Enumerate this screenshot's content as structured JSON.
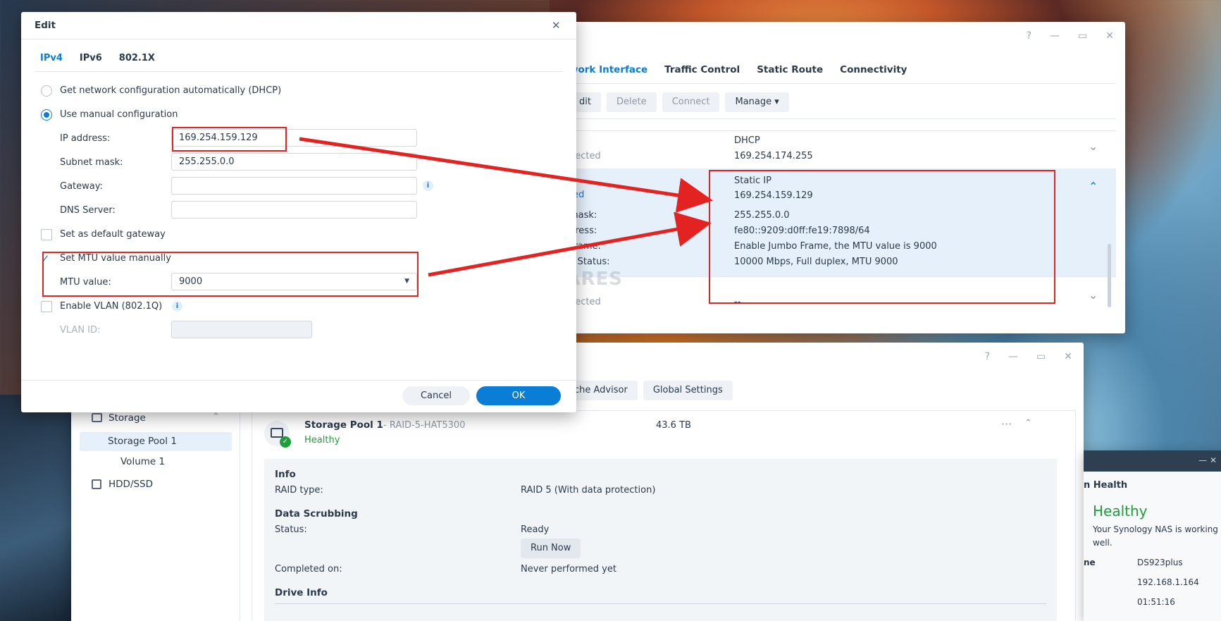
{
  "desktop": {
    "note": ""
  },
  "network_window": {
    "window_controls": {
      "help": "?",
      "minimize": "—",
      "maximize": "▭",
      "close": "✕"
    },
    "tabs": [
      "work Interface",
      "Traffic Control",
      "Static Route",
      "Connectivity"
    ],
    "toolbar": {
      "edit": "dit",
      "delete": "Delete",
      "connect": "Connect",
      "manage": "Manage ▾"
    },
    "row1": {
      "status": "nected",
      "mode": "DHCP",
      "ip": "169.254.174.255"
    },
    "row2": {
      "status": "ted",
      "mode": "Static IP",
      "ip": "169.254.159.129",
      "labels": [
        "mask:",
        "dress:",
        "Frame:",
        "k Status:"
      ],
      "values": [
        "255.255.0.0",
        "fe80::9209:d0ff:fe19:7898/64",
        "Enable Jumbo Frame, the MTU value is 9000",
        "10000 Mbps, Full duplex, MTU 9000"
      ]
    },
    "row3": {
      "status": "nected",
      "value": "--"
    },
    "watermark": "NAS COMPARES"
  },
  "edit_dialog": {
    "title": "Edit",
    "close": "✕",
    "tabs": [
      "IPv4",
      "IPv6",
      "802.1X"
    ],
    "dhcp_label": "Get network configuration automatically (DHCP)",
    "manual_label": "Use manual configuration",
    "ip_label": "IP address:",
    "ip_value": "169.254.159.129",
    "subnet_label": "Subnet mask:",
    "subnet_value": "255.255.0.0",
    "gateway_label": "Gateway:",
    "gateway_value": "",
    "dns_label": "DNS Server:",
    "dns_value": "",
    "default_gw_label": "Set as default gateway",
    "mtu_check_label": "Set MTU value manually",
    "mtu_label": "MTU value:",
    "mtu_value": "9000",
    "vlan_label": "Enable VLAN (802.1Q)",
    "vlan_id_label": "VLAN ID:",
    "vlan_id_value": "",
    "info_glyph": "i",
    "cancel": "Cancel",
    "ok": "OK"
  },
  "storage_window": {
    "window_controls": {
      "help": "?",
      "minimize": "—",
      "maximize": "▭",
      "close": "✕"
    },
    "toolbar": {
      "cache_advisor": "che Advisor",
      "global_settings": "Global Settings"
    },
    "sidebar": {
      "storage": "Storage",
      "pool": "Storage Pool 1",
      "volume": "Volume 1",
      "hdd": "HDD/SSD"
    },
    "pool": {
      "name": "Storage Pool 1",
      "sub": "- RAID-5-HAT5300",
      "size": "43.6 TB",
      "health": "Healthy",
      "more": "···",
      "collapse": "⌃"
    },
    "info": {
      "info_h": "Info",
      "raid_label": "RAID type:",
      "raid_value": "RAID 5 (With data protection)",
      "scrub_h": "Data Scrubbing",
      "status_label": "Status:",
      "status_value": "Ready",
      "run_now": "Run Now",
      "completed_label": "Completed on:",
      "completed_value": "Never performed yet",
      "drive_h": "Drive Info"
    }
  },
  "health_widget": {
    "title": "n Health",
    "status": "Healthy",
    "desc": "Your Synology NAS is working well.",
    "name_label": "ne",
    "name_value": "DS923plus",
    "ip_value": "192.168.1.164",
    "time_value": "01:51:16",
    "controls": "—   ✕"
  },
  "colors": {
    "accent": "#0a7dd7",
    "healthy": "#1e9e3a",
    "annotation": "#e32222",
    "selected_row": "#e6f0fa"
  }
}
